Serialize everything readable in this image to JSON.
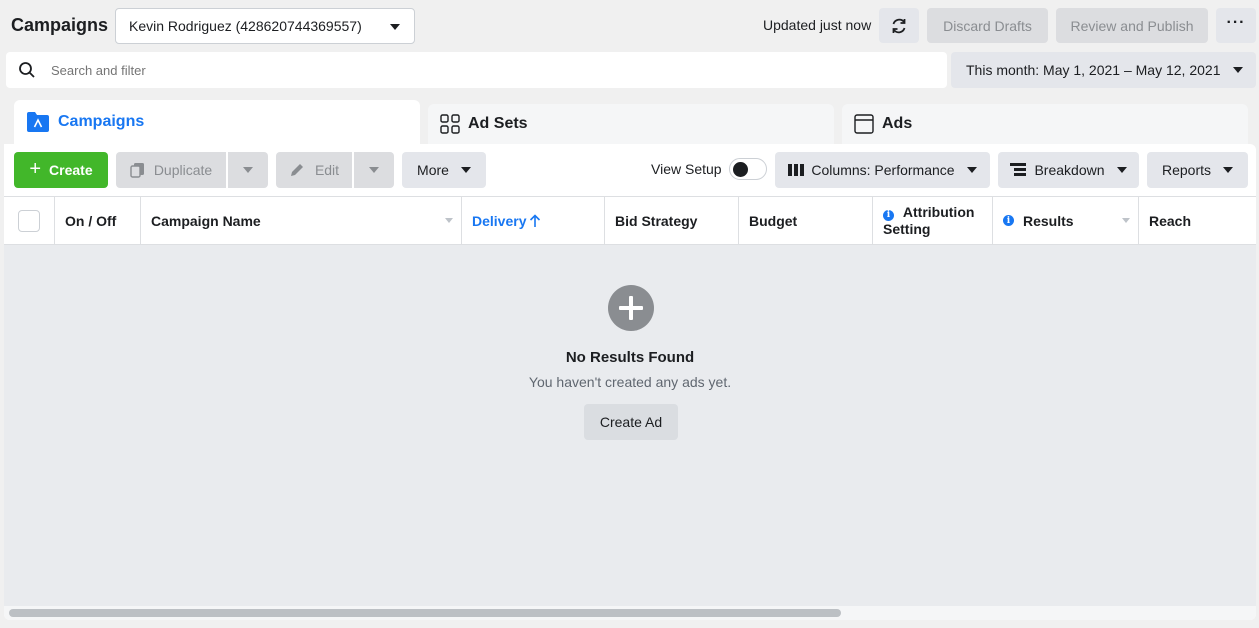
{
  "header": {
    "title": "Campaigns",
    "account": "Kevin Rodriguez (428620744369557)",
    "updated": "Updated just now",
    "discard": "Discard Drafts",
    "review": "Review and Publish",
    "more_icon": "ellipsis-icon"
  },
  "search": {
    "placeholder": "Search and filter"
  },
  "date_range": "This month: May 1, 2021 – May 12, 2021",
  "tabs": [
    {
      "label": "Campaigns",
      "icon": "folder-icon",
      "active": true
    },
    {
      "label": "Ad Sets",
      "icon": "grid-icon"
    },
    {
      "label": "Ads",
      "icon": "window-icon"
    }
  ],
  "toolbar": {
    "create": "Create",
    "duplicate": "Duplicate",
    "edit": "Edit",
    "more": "More",
    "view_setup": "View Setup",
    "columns": "Columns: Performance",
    "breakdown": "Breakdown",
    "reports": "Reports"
  },
  "table": {
    "headers": {
      "on_off": "On / Off",
      "name": "Campaign Name",
      "delivery": "Delivery",
      "bid": "Bid Strategy",
      "budget": "Budget",
      "attribution_1": "Attribution",
      "attribution_2": "Setting",
      "results": "Results",
      "reach": "Reach"
    }
  },
  "empty": {
    "title": "No Results Found",
    "subtitle": "You haven't created any ads yet.",
    "button": "Create Ad"
  },
  "colors": {
    "accent": "#1877f2",
    "create": "#42b72a"
  }
}
